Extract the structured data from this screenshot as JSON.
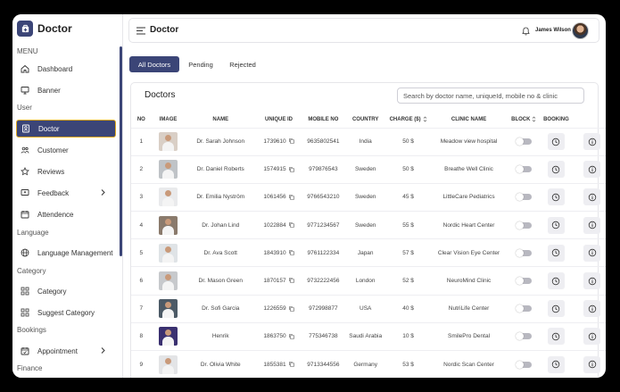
{
  "brand": {
    "name": "Doctor"
  },
  "sidebar": {
    "sections": [
      {
        "label": "MENU"
      },
      {
        "label": "User"
      },
      {
        "label": "Language"
      },
      {
        "label": "Category"
      },
      {
        "label": "Bookings"
      },
      {
        "label": "Finance"
      }
    ],
    "items": [
      {
        "label": "Dashboard",
        "icon": "home-icon"
      },
      {
        "label": "Banner",
        "icon": "monitor-icon"
      },
      {
        "label": "Doctor",
        "icon": "badge-icon"
      },
      {
        "label": "Customer",
        "icon": "users-icon"
      },
      {
        "label": "Reviews",
        "icon": "star-icon"
      },
      {
        "label": "Feedback",
        "icon": "feedback-icon"
      },
      {
        "label": "Attendence",
        "icon": "calendar-icon"
      },
      {
        "label": "Language Management",
        "icon": "globe-icon"
      },
      {
        "label": "Category",
        "icon": "grid-icon"
      },
      {
        "label": "Suggest Category",
        "icon": "grid-icon"
      },
      {
        "label": "Appointment",
        "icon": "calendar-check-icon"
      }
    ]
  },
  "header": {
    "title": "Doctor",
    "user_name": "James Wilson"
  },
  "tabs": [
    {
      "label": "All Doctors"
    },
    {
      "label": "Pending"
    },
    {
      "label": "Rejected"
    }
  ],
  "card": {
    "title": "Doctors",
    "search_placeholder": "Search by doctor name, uniqueId, mobile no & clinic"
  },
  "table": {
    "headers": [
      "NO",
      "IMAGE",
      "NAME",
      "UNIQUE ID",
      "MOBILE NO",
      "COUNTRY",
      "CHARGE ($)",
      "CLINIC NAME",
      "BLOCK",
      "BOOKING"
    ],
    "rows": [
      {
        "no": "1",
        "name": "Dr. Sarah Johnson",
        "uid": "1739610",
        "mobile": "9635802541",
        "country": "India",
        "charge": "50 $",
        "clinic": "Meadow view hospital",
        "photo": "#d9cfc6"
      },
      {
        "no": "2",
        "name": "Dr. Daniel Roberts",
        "uid": "1574915",
        "mobile": "979876543",
        "country": "Sweden",
        "charge": "50 $",
        "clinic": "Breathe Well Clinic",
        "photo": "#bfc3c7"
      },
      {
        "no": "3",
        "name": "Dr. Emilia Nyström",
        "uid": "1061456",
        "mobile": "9766543210",
        "country": "Sweden",
        "charge": "45 $",
        "clinic": "LittleCare Pediatrics",
        "photo": "#e9eaec"
      },
      {
        "no": "4",
        "name": "Dr. Johan Lind",
        "uid": "1022884",
        "mobile": "9771234567",
        "country": "Sweden",
        "charge": "55 $",
        "clinic": "Nordic Heart Center",
        "photo": "#8a7a6c"
      },
      {
        "no": "5",
        "name": "Dr. Ava Scott",
        "uid": "1843910",
        "mobile": "9761122334",
        "country": "Japan",
        "charge": "57 $",
        "clinic": "Clear Vision Eye Center",
        "photo": "#dfe3e6"
      },
      {
        "no": "6",
        "name": "Dr. Mason Green",
        "uid": "1870157",
        "mobile": "9732222456",
        "country": "London",
        "charge": "52 $",
        "clinic": "NeuroMind Clinic",
        "photo": "#c7c9cc"
      },
      {
        "no": "7",
        "name": "Dr. Sofi Garcia",
        "uid": "1226559",
        "mobile": "972998877",
        "country": "USA",
        "charge": "40 $",
        "clinic": "NutriLife Center",
        "photo": "#4c5a66"
      },
      {
        "no": "8",
        "name": "Henrik",
        "uid": "1863750",
        "mobile": "775346738",
        "country": "Saudi Arabia",
        "charge": "10 $",
        "clinic": "SmilePro Dental",
        "photo": "#3a3070"
      },
      {
        "no": "9",
        "name": "Dr. Olivia White",
        "uid": "1855381",
        "mobile": "9713344556",
        "country": "Germany",
        "charge": "53 $",
        "clinic": "Nordic Scan Center",
        "photo": "#e3e4e6"
      }
    ]
  },
  "colors": {
    "accent": "#3b4577",
    "active_border": "#e0a91c"
  }
}
